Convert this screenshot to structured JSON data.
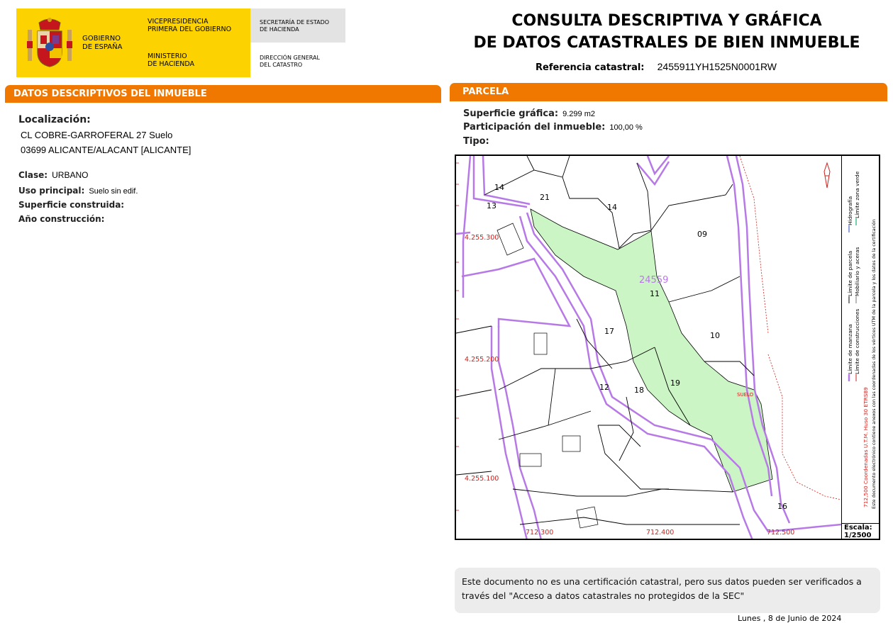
{
  "header": {
    "gobierno": [
      "GOBIERNO",
      "DE ESPAÑA"
    ],
    "vicepresidencia": [
      "VICEPRESIDENCIA",
      "PRIMERA DEL GOBIERNO"
    ],
    "ministerio": [
      "MINISTERIO",
      "DE HACIENDA"
    ],
    "secretaria": [
      "SECRETARÍA DE ESTADO",
      "DE HACIENDA"
    ],
    "direccion": [
      "DIRECCIÓN GENERAL",
      "DEL CATASTRO"
    ]
  },
  "title": {
    "line1": "CONSULTA DESCRIPTIVA Y GRÁFICA",
    "line2": "DE DATOS CATASTRALES DE BIEN INMUEBLE",
    "ref_label": "Referencia catastral:",
    "ref_value": "2455911YH1525N0001RW"
  },
  "descriptivos": {
    "heading": "DATOS DESCRIPTIVOS DEL INMUEBLE",
    "localizacion_label": "Localización:",
    "localizacion_line1": "CL COBRE-GARROFERAL 27 Suelo",
    "localizacion_line2": "03699 ALICANTE/ALACANT [ALICANTE]",
    "clase_label": "Clase:",
    "clase_value": "URBANO",
    "uso_label": "Uso principal:",
    "uso_value": "Suelo sin edif.",
    "superficie_label": "Superficie construida:",
    "ano_label": "Año construcción:"
  },
  "parcela": {
    "heading": "PARCELA",
    "sup_label": "Superficie gráfica:",
    "sup_value": "9.299 m2",
    "part_label": "Participación del inmueble:",
    "part_value": "100,00 %",
    "tipo_label": "Tipo:"
  },
  "map": {
    "parcel_code": "24559",
    "suelo_label": "SUELO",
    "lot_numbers": [
      "14",
      "21",
      "13",
      "14",
      "09",
      "11",
      "10",
      "17",
      "18",
      "19",
      "12",
      "16"
    ],
    "y_ticks": [
      "4.255.300",
      "4.255.200",
      "4.255.100"
    ],
    "x_ticks": [
      "712.300",
      "712.400",
      "712.500"
    ],
    "legend": {
      "manzana": "Límite de manzana",
      "parcela": "Límite de parcela",
      "hidrografia": "Hidrografía",
      "construcciones": "Límite de construcciones",
      "mobiliario": "Mobiliario y aceras",
      "zona_verde": "Límite zona verde",
      "coords": "712,500 Coordenadas U.T.M. Huso 30 ETRS89",
      "nota": "Este documento electrónico contiene anexos con las coordenadas de los vértices UTM de la parcela y los datos de la certificación"
    },
    "escala_label": "Escala:",
    "escala_value": "1/2500",
    "colors": {
      "manzana": "#b779e6",
      "parcel_fill": "#ccf5c5",
      "red": "#d0201c"
    }
  },
  "notice": {
    "line1": "Este documento no es una certificación catastral, pero sus datos pueden ser verificados a",
    "line2": "través del \"Acceso a datos catastrales no protegidos de la SEC\""
  },
  "footer": {
    "date": "Lunes , 8 de Junio de 2024"
  }
}
